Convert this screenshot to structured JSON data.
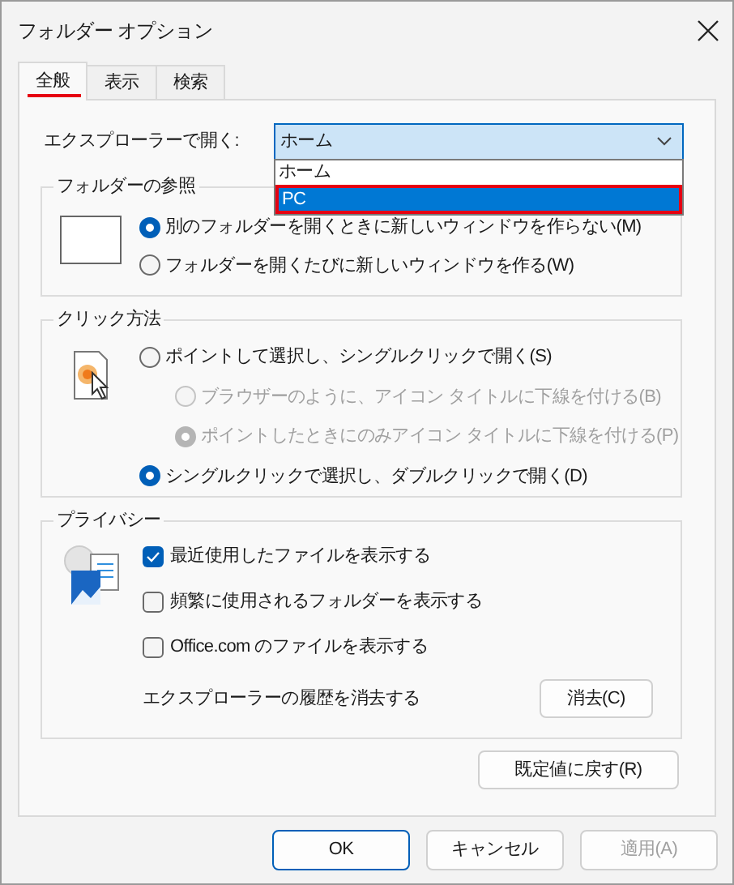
{
  "window": {
    "title": "フォルダー オプション"
  },
  "tabs": [
    {
      "label": "全般",
      "selected": true
    },
    {
      "label": "表示",
      "selected": false
    },
    {
      "label": "検索",
      "selected": false
    }
  ],
  "open_explorer": {
    "label": "エクスプローラーで開く:",
    "value": "ホーム",
    "options": [
      {
        "label": "ホーム",
        "highlighted": false
      },
      {
        "label": "PC",
        "highlighted": true
      }
    ]
  },
  "browse_folders": {
    "title": "フォルダーの参照",
    "options": [
      {
        "label": "別のフォルダーを開くときに新しいウィンドウを作らない(M)",
        "selected": true,
        "disabled": false
      },
      {
        "label": "フォルダーを開くたびに新しいウィンドウを作る(W)",
        "selected": false,
        "disabled": false
      }
    ]
  },
  "click_items": {
    "title": "クリック方法",
    "options": [
      {
        "label": "ポイントして選択し、シングルクリックで開く(S)",
        "selected": false,
        "disabled": false,
        "children": [
          {
            "label": "ブラウザーのように、アイコン タイトルに下線を付ける(B)",
            "selected": false,
            "disabled": true
          },
          {
            "label": "ポイントしたときにのみアイコン タイトルに下線を付ける(P)",
            "selected": true,
            "disabled": true
          }
        ]
      },
      {
        "label": "シングルクリックで選択し、ダブルクリックで開く(D)",
        "selected": true,
        "disabled": false
      }
    ]
  },
  "privacy": {
    "title": "プライバシー",
    "checkboxes": [
      {
        "label": "最近使用したファイルを表示する",
        "checked": true
      },
      {
        "label": "頻繁に使用されるフォルダーを表示する",
        "checked": false
      },
      {
        "label": "Office.com のファイルを表示する",
        "checked": false
      }
    ],
    "clear_label": "エクスプローラーの履歴を消去する",
    "clear_button": "消去(C)"
  },
  "restore_button": "既定値に戻す(R)",
  "buttons": [
    {
      "label": "OK",
      "default": true,
      "disabled": false
    },
    {
      "label": "キャンセル",
      "default": false,
      "disabled": false
    },
    {
      "label": "適用(A)",
      "default": false,
      "disabled": true
    }
  ]
}
